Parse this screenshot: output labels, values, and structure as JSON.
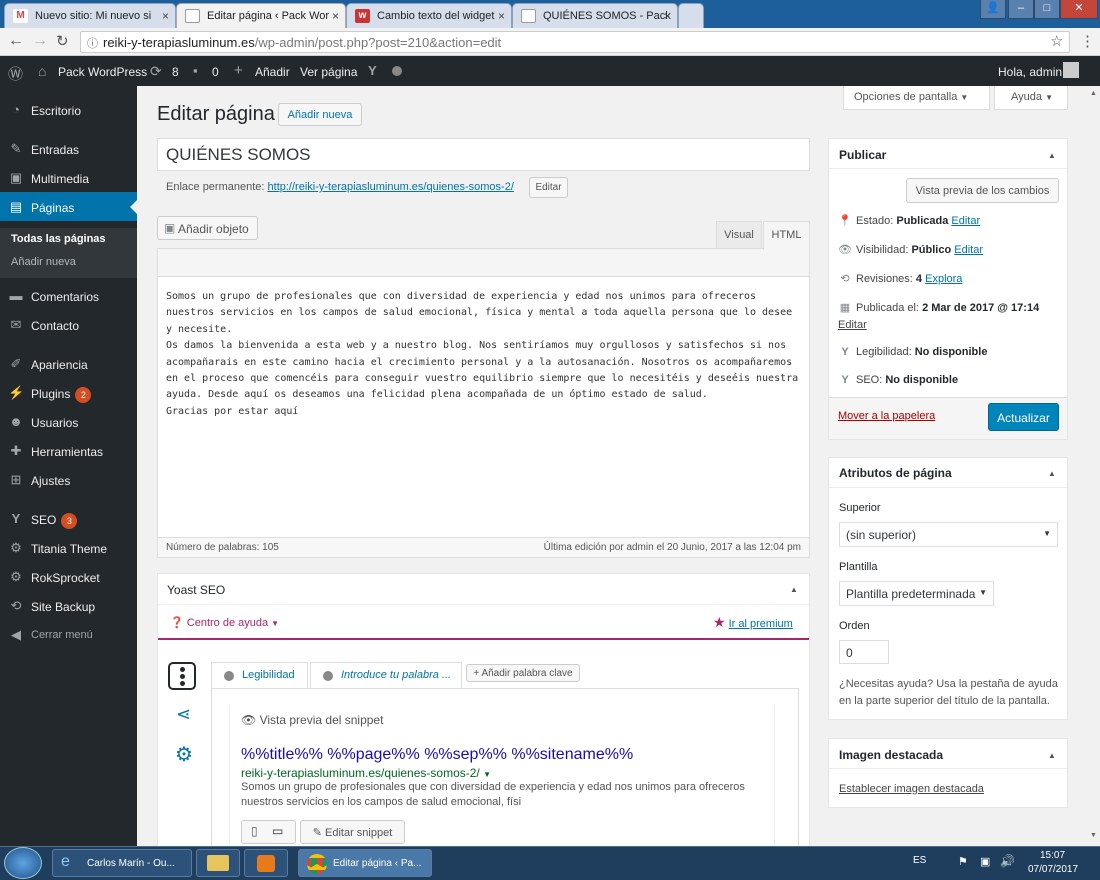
{
  "browser": {
    "tabs": [
      {
        "title": "Nuevo sitio: Mi nuevo si",
        "icon": "gmail-icon"
      },
      {
        "title": "Editar página ‹ Pack Wor",
        "icon": "page-icon"
      },
      {
        "title": "Cambio texto del widget",
        "icon": "w-icon"
      },
      {
        "title": "QUIÉNES SOMOS - Pack",
        "icon": "page-icon"
      }
    ],
    "url_host": "reiki-y-terapiasluminum.es",
    "url_path": "/wp-admin/post.php?post=210&action=edit"
  },
  "adminbar": {
    "site": "Pack WordPress",
    "updates": "8",
    "comments": "0",
    "add_new": "Añadir",
    "view_page": "Ver página",
    "greeting": "Hola, admin"
  },
  "sidebar": {
    "items": [
      {
        "label": "Escritorio",
        "icon": "dashboard-icon"
      },
      {
        "label": "Entradas",
        "icon": "pin-icon"
      },
      {
        "label": "Multimedia",
        "icon": "media-icon"
      },
      {
        "label": "Páginas",
        "icon": "pages-icon"
      },
      {
        "label": "Comentarios",
        "icon": "comment-icon"
      },
      {
        "label": "Contacto",
        "icon": "mail-icon"
      },
      {
        "label": "Apariencia",
        "icon": "brush-icon"
      },
      {
        "label": "Plugins",
        "icon": "plugin-icon",
        "badge": "2"
      },
      {
        "label": "Usuarios",
        "icon": "users-icon"
      },
      {
        "label": "Herramientas",
        "icon": "tools-icon"
      },
      {
        "label": "Ajustes",
        "icon": "settings-icon"
      },
      {
        "label": "SEO",
        "icon": "yoast-icon",
        "badge": "3"
      },
      {
        "label": "Titania Theme",
        "icon": "gear-icon"
      },
      {
        "label": "RokSprocket",
        "icon": "rocket-icon"
      },
      {
        "label": "Site Backup",
        "icon": "backup-icon"
      },
      {
        "label": "Cerrar menú",
        "icon": "collapse-icon"
      }
    ],
    "submenu": [
      "Todas las páginas",
      "Añadir nueva"
    ]
  },
  "screen_options": "Opciones de pantalla",
  "help": "Ayuda",
  "page_title": "Editar página",
  "add_new_button": "Añadir nueva",
  "post_title": "QUIÉNES SOMOS",
  "permalink": {
    "label": "Enlace permanente:",
    "url": "http://reiki-y-terapiasluminum.es/quienes-somos-2/",
    "edit": "Editar"
  },
  "editor": {
    "add_media": "Añadir objeto",
    "tab_visual": "Visual",
    "tab_html": "HTML",
    "content": "Somos un grupo de profesionales que con diversidad de experiencia y edad nos unimos para ofreceros nuestros servicios en los campos de salud emocional, física y mental a toda aquella persona que lo desee y necesite.\nOs damos la bienvenida a esta web y a nuestro blog. Nos sentiríamos muy orgullosos y satisfechos si nos acompañarais en este camino hacia el crecimiento personal y a la autosanación. Nosotros os acompañaremos en el proceso que comencéis para conseguir vuestro equilibrio siempre que lo necesitéis y deseéis nuestra ayuda. Desde aquí os deseamos una felicidad plena acompañada de un óptimo estado de salud.\nGracias por estar aquí",
    "word_count": "Número de palabras: 105",
    "last_edit": "Última edición por admin el 20 Junio, 2017 a las 12:04 pm"
  },
  "yoast": {
    "title": "Yoast SEO",
    "help_center": "Centro de ayuda",
    "premium": "Ir al premium",
    "tab_readability": "Legibilidad",
    "tab_keyword": "Introduce tu palabra ...",
    "add_keyword": "+ Añadir palabra clave",
    "snippet_title": "Vista previa del snippet",
    "snippet_seo_title": "%%title%% %%page%% %%sep%% %%sitename%%",
    "snippet_url": "reiki-y-terapiasluminum.es/quienes-somos-2/",
    "snippet_desc": "Somos un grupo de profesionales que con diversidad de experiencia y edad nos unimos para ofreceros nuestros servicios en los campos de salud emocional, físi",
    "edit_snippet": "Editar snippet"
  },
  "publish": {
    "title": "Publicar",
    "preview": "Vista previa de los cambios",
    "status_label": "Estado:",
    "status_value": "Publicada",
    "visibility_label": "Visibilidad:",
    "visibility_value": "Público",
    "revisions_label": "Revisiones:",
    "revisions_value": "4",
    "revisions_link": "Explora",
    "published_label": "Publicada el:",
    "published_value": "2 Mar de 2017 @ 17:14",
    "readability_label": "Legibilidad:",
    "readability_value": "No disponible",
    "seo_label": "SEO:",
    "seo_value": "No disponible",
    "edit": "Editar",
    "trash": "Mover a la papelera",
    "update": "Actualizar"
  },
  "attributes": {
    "title": "Atributos de página",
    "parent_label": "Superior",
    "parent_value": "(sin superior)",
    "template_label": "Plantilla",
    "template_value": "Plantilla predeterminada",
    "order_label": "Orden",
    "order_value": "0",
    "help_text_1": "¿Necesitas ayuda? Usa la pestaña de ayuda",
    "help_text_2": "en la parte superior del título de la pantalla."
  },
  "featured": {
    "title": "Imagen destacada",
    "set": "Establecer imagen destacada"
  },
  "taskbar": {
    "items": [
      "Carlos Marín - Ou...",
      "Editar página ‹ Pa..."
    ],
    "lang": "ES",
    "time": "15:07",
    "date": "07/07/2017"
  },
  "colors": {
    "accent": "#0073aa",
    "admin_bg": "#23282d",
    "yoast": "#a4286a"
  }
}
